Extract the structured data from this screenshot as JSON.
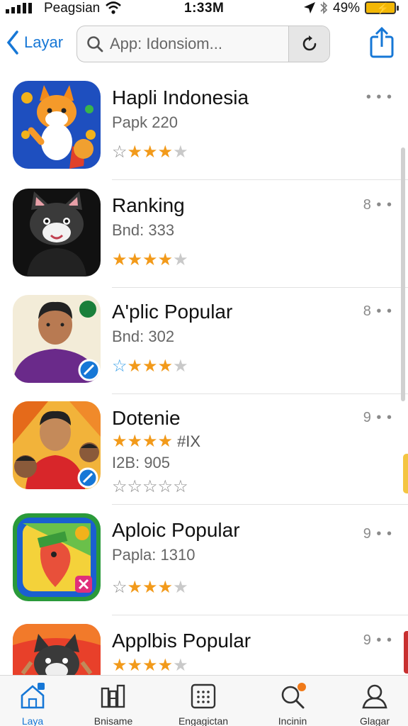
{
  "status_bar": {
    "carrier": "Peagsian",
    "time": "1:33M",
    "battery": "49%"
  },
  "nav": {
    "back_label": "Layar",
    "search_placeholder": "App: Idonsiom..."
  },
  "apps": [
    {
      "title": "Hapli Indonesia",
      "subtitle": "Papk 220",
      "stars": "☆★★★☆",
      "more": "• • •"
    },
    {
      "title": "Ranking",
      "subtitle": "Bnd: 333",
      "stars": "★★★★☆",
      "more": "8 • •"
    },
    {
      "title": "A'plic Popular",
      "subtitle": "Bnd: 302",
      "stars": "☆★★★☆",
      "more": "8 • •"
    },
    {
      "title": "Dotenie",
      "stars_top": "★★★★",
      "stars_tag": "#IX",
      "subtitle": "I2B: 905",
      "stars": "☆☆☆☆☆",
      "more": "9 • •"
    },
    {
      "title": "Aploic Popular",
      "subtitle": "Papla: 1310",
      "stars": "☆★★★☆",
      "more": "9 • •"
    },
    {
      "title": "Applbis Popular",
      "stars": "★★★★☆",
      "more": "9 • •"
    }
  ],
  "tabs": [
    {
      "label": "Laya",
      "icon": "home-icon"
    },
    {
      "label": "Bnisame",
      "icon": "books-icon"
    },
    {
      "label": "Engagictan",
      "icon": "grid-icon"
    },
    {
      "label": "Incinin",
      "icon": "search-icon"
    },
    {
      "label": "Glagar",
      "icon": "person-icon"
    }
  ],
  "colors": {
    "accent": "#1677d6",
    "star": "#f29a1a",
    "badge": "#f07a1a"
  }
}
